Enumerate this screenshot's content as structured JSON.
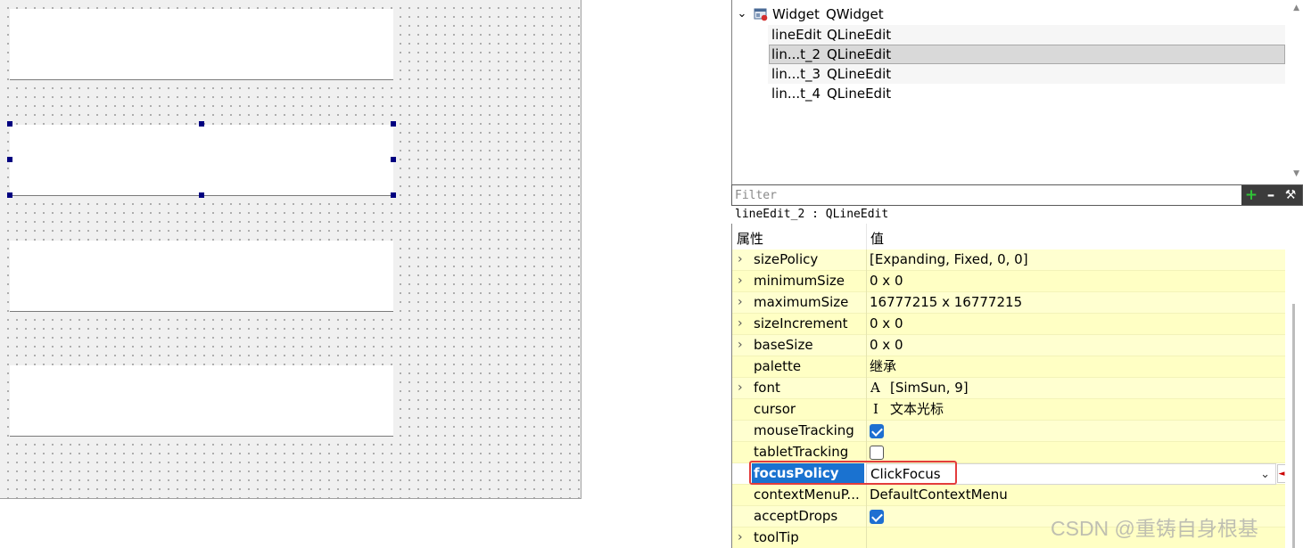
{
  "object_inspector": {
    "rows": [
      {
        "name": "Widget",
        "class": "QWidget"
      },
      {
        "name": "lineEdit",
        "class": "QLineEdit"
      },
      {
        "name": "lin...t_2",
        "class": "QLineEdit"
      },
      {
        "name": "lin...t_3",
        "class": "QLineEdit"
      },
      {
        "name": "lin...t_4",
        "class": "QLineEdit"
      }
    ],
    "selected_index": 2
  },
  "filter": {
    "placeholder": "Filter"
  },
  "current_object": "lineEdit_2 : QLineEdit",
  "property_editor": {
    "header": {
      "property": "属性",
      "value": "值"
    },
    "rows": [
      {
        "name": "sizePolicy",
        "value": "[Expanding, Fixed, 0, 0]",
        "expandable": true
      },
      {
        "name": "minimumSize",
        "value": "0 x 0",
        "expandable": true
      },
      {
        "name": "maximumSize",
        "value": "16777215 x 16777215",
        "expandable": true
      },
      {
        "name": "sizeIncrement",
        "value": "0 x 0",
        "expandable": true
      },
      {
        "name": "baseSize",
        "value": "0 x 0",
        "expandable": true
      },
      {
        "name": "palette",
        "value": "继承",
        "expandable": false
      },
      {
        "name": "font",
        "glyph": "A",
        "value": "[SimSun, 9]",
        "expandable": true
      },
      {
        "name": "cursor",
        "glyph": "I",
        "value": "文本光标",
        "expandable": false
      },
      {
        "name": "mouseTracking",
        "checked": true,
        "expandable": false
      },
      {
        "name": "tabletTracking",
        "checked": false,
        "expandable": false
      },
      {
        "name": "focusPolicy",
        "value": "ClickFocus",
        "expandable": false,
        "selected": true
      },
      {
        "name": "contextMenuP...",
        "value": "DefaultContextMenu",
        "expandable": false
      },
      {
        "name": "acceptDrops",
        "checked": true,
        "expandable": false
      },
      {
        "name": "toolTip",
        "value": "",
        "expandable": true
      }
    ]
  },
  "icons": {
    "tree_expand": "chevron-down-icon",
    "row_expand": "chevron-right-icon",
    "add": "plus-icon",
    "remove": "minus-icon",
    "configure": "wrench-icon"
  },
  "colors": {
    "property_row": "#ffffd0",
    "selected_property": "#1a72d0",
    "highlight_box": "#e33c3c",
    "checkbox": "#1e6fd1"
  },
  "watermark": "CSDN @重铸自身根基"
}
